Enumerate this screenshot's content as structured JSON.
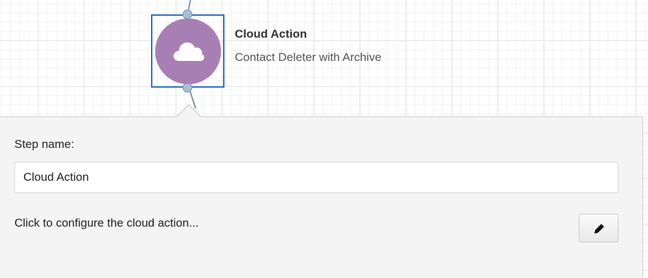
{
  "node": {
    "title": "Cloud Action",
    "subtitle": "Contact Deleter with Archive",
    "icon": "cloud-icon",
    "color": "#a77fb5",
    "selection_color": "#1a72c4"
  },
  "panel": {
    "step_name_label": "Step name:",
    "step_name_value": "Cloud Action",
    "configure_text": "Click to configure the cloud action...",
    "edit_icon": "pencil-icon"
  }
}
